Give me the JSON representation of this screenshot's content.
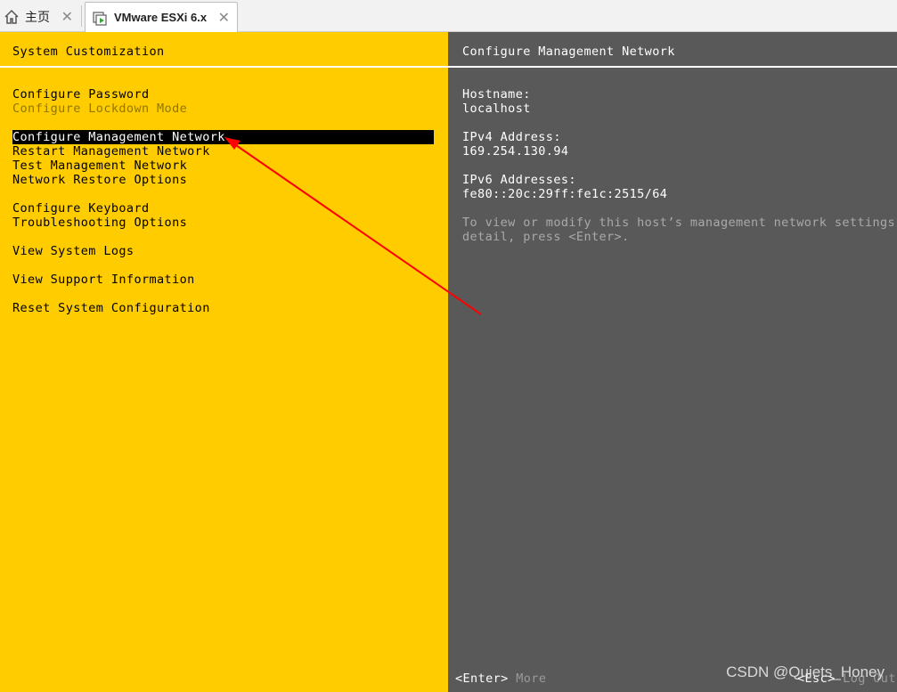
{
  "tabs": [
    {
      "label": "主页",
      "icon": "home-icon",
      "close": "✕"
    },
    {
      "label": "VMware ESXi 6.x",
      "icon": "vm-icon",
      "close": "✕"
    }
  ],
  "left_pane": {
    "title": "System Customization",
    "items": [
      {
        "label": "Configure Password"
      },
      {
        "label": "Configure Lockdown Mode"
      },
      {
        "label": "Configure Management Network"
      },
      {
        "label": "Restart Management Network"
      },
      {
        "label": "Test Management Network"
      },
      {
        "label": "Network Restore Options"
      },
      {
        "label": "Configure Keyboard"
      },
      {
        "label": "Troubleshooting Options"
      },
      {
        "label": "View System Logs"
      },
      {
        "label": "View Support Information"
      },
      {
        "label": "Reset System Configuration"
      }
    ]
  },
  "right_pane": {
    "title": "Configure Management Network",
    "hostname_label": "Hostname:",
    "hostname_value": "localhost",
    "ipv4_label": "IPv4 Address:",
    "ipv4_value": "169.254.130.94",
    "ipv6_label": "IPv6 Addresses:",
    "ipv6_value": "fe80::20c:29ff:fe1c:2515/64",
    "help_line1": "To view or modify this host’s management network settings in",
    "help_line2": "detail, press <Enter>.",
    "footer_enter_key": "<Enter>",
    "footer_enter_label": "More",
    "footer_esc_key": "<Esc>",
    "footer_esc_label": "Log Out"
  },
  "watermark": "CSDN @Quiets_Honey",
  "annotation_color": "#ff0000"
}
